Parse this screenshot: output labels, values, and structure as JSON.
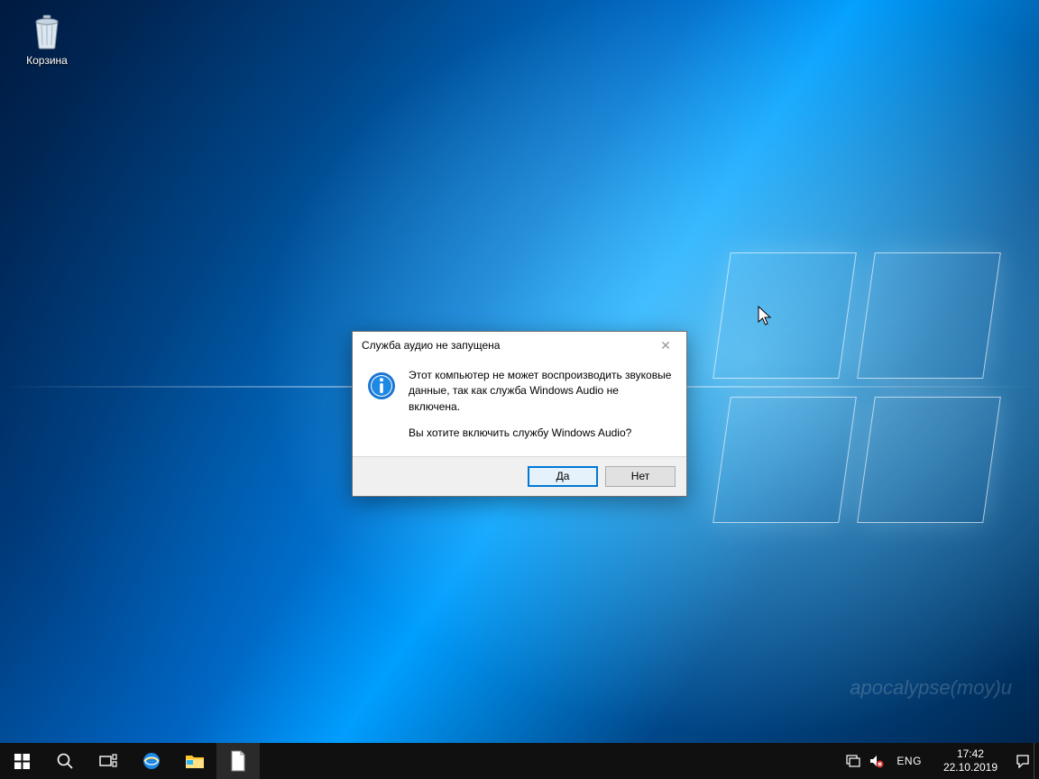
{
  "desktop": {
    "recycle_bin_label": "Корзина",
    "watermark": "apocalypse(moy)u"
  },
  "dialog": {
    "title": "Служба аудио не запущена",
    "message_line1": "Этот компьютер не может воспроизводить звуковые данные, так как служба Windows Audio не включена.",
    "message_line2": "Вы хотите включить службу Windows Audio?",
    "yes_label": "Да",
    "no_label": "Нет"
  },
  "taskbar": {
    "language": "ENG",
    "time": "17:42",
    "date": "22.10.2019"
  }
}
